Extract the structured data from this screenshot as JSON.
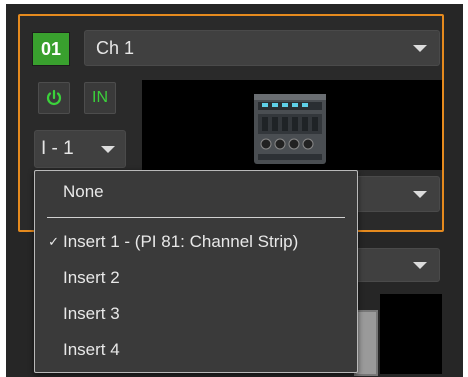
{
  "channel": {
    "number": "01",
    "name": "Ch 1",
    "power_icon": "power-icon",
    "input_label": "IN",
    "insert_value": "I - 1"
  },
  "insert_menu": {
    "items": [
      {
        "label": "None",
        "checked": false
      },
      {
        "label": "Insert 1 - (PI 81: Channel Strip)",
        "checked": true
      },
      {
        "label": "Insert 2",
        "checked": false
      },
      {
        "label": "Insert 3",
        "checked": false
      },
      {
        "label": "Insert 4",
        "checked": false
      }
    ],
    "check_glyph": "✓"
  },
  "colors": {
    "accent": "#e58a1e",
    "channel_number_bg": "#39a02e",
    "active_green": "#3bd13b"
  }
}
